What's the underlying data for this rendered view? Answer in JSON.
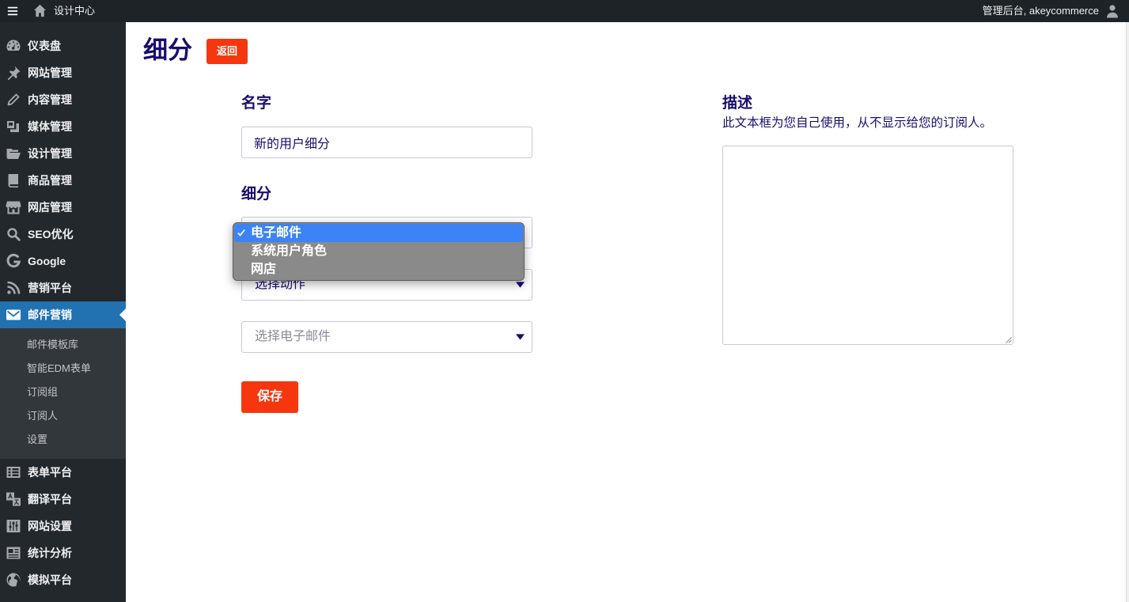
{
  "topbar": {
    "menu_icon": "hamburger-icon",
    "home_icon": "home-icon",
    "site_name": "设计中心",
    "account_text": "管理后台, akeycommerce",
    "user_icon": "user-icon"
  },
  "sidebar": {
    "items": [
      {
        "label": "仪表盘",
        "icon": "dashboard-icon"
      },
      {
        "label": "网站管理",
        "icon": "pin-icon"
      },
      {
        "label": "内容管理",
        "icon": "pencil-icon"
      },
      {
        "label": "媒体管理",
        "icon": "media-icon"
      },
      {
        "label": "设计管理",
        "icon": "folder-icon"
      },
      {
        "label": "商品管理",
        "icon": "book-icon"
      },
      {
        "label": "网店管理",
        "icon": "store-icon"
      },
      {
        "label": "SEO优化",
        "icon": "search-icon"
      },
      {
        "label": "Google",
        "icon": "google-icon"
      },
      {
        "label": "营销平台",
        "icon": "rss-icon"
      },
      {
        "label": "邮件营销",
        "icon": "mail-icon",
        "active": true
      },
      {
        "label": "表单平台",
        "icon": "form-icon"
      },
      {
        "label": "翻译平台",
        "icon": "translate-icon"
      },
      {
        "label": "网站设置",
        "icon": "settings-icon"
      },
      {
        "label": "统计分析",
        "icon": "analytics-icon"
      },
      {
        "label": "模拟平台",
        "icon": "globe-icon"
      }
    ],
    "submenu": [
      {
        "label": "邮件模板库"
      },
      {
        "label": "智能EDM表单"
      },
      {
        "label": "订阅组"
      },
      {
        "label": "订阅人"
      },
      {
        "label": "设置"
      }
    ]
  },
  "page": {
    "title": "细分",
    "back_label": "返回"
  },
  "form": {
    "name": {
      "label": "名字",
      "value": "新的用户细分"
    },
    "segment": {
      "label": "细分",
      "type_select": {
        "options": [
          "电子邮件",
          "系统用户角色",
          "网店"
        ],
        "selected_index": 0,
        "open": true
      },
      "action_select": {
        "value": "选择动作"
      },
      "email_select": {
        "placeholder": "选择电子邮件"
      }
    },
    "save_label": "保存",
    "description": {
      "label": "描述",
      "help": "此文本框为您自己使用，从不显示给您的订阅人。",
      "value": ""
    }
  },
  "colors": {
    "topbar_bg": "#1d2327",
    "sidebar_bg": "#23282d",
    "submenu_bg": "#32373c",
    "active_bg": "#2271b1",
    "text_navy": "#170d6e",
    "button_red": "#f5360f",
    "dropdown_highlight": "#3b83f6",
    "input_border": "#c8c5dd"
  }
}
